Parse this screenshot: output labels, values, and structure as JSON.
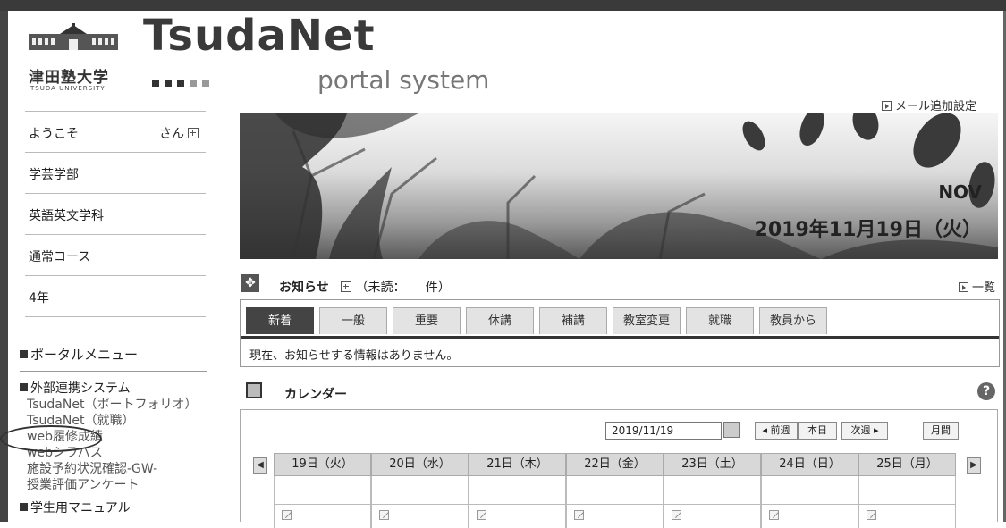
{
  "header": {
    "logo_jp": "津田塾大学",
    "logo_en": "TSUDA UNIVERSITY",
    "title": "TsudaNet",
    "subtitle": "portal system",
    "mail_setting": "メール追加設定"
  },
  "sidebar": {
    "welcome": "ようこそ",
    "san": "さん",
    "items": [
      "学芸学部",
      "英語英文学科",
      "通常コース",
      "4年"
    ],
    "portal_menu": "ポータルメニュー",
    "external_system": "外部連携システム",
    "external_links": [
      "TsudaNet（ポートフォリオ）",
      "TsudaNet（就職）",
      "web履修成績",
      "webシラバス",
      "施設予約状況確認-GW-",
      "授業評価アンケート"
    ],
    "student_manual": "学生用マニュアル"
  },
  "banner": {
    "month": "NOV",
    "date": "2019年11月19日（火）"
  },
  "notice": {
    "title": "お知らせ",
    "unread_prefix": "（未読：",
    "unread_suffix": "件）",
    "list_link": "一覧",
    "tabs": [
      "新着",
      "一般",
      "重要",
      "休講",
      "補講",
      "教室変更",
      "就職",
      "教員から"
    ],
    "active_tab": "新着",
    "empty_message": "現在、お知らせする情報はありません。"
  },
  "calendar": {
    "title": "カレンダー",
    "date_value": "2019/11/19",
    "prev_week": "◂ 前週",
    "today": "本日",
    "next_week": "次週 ▸",
    "month_view": "月間",
    "days": [
      "19日（火）",
      "20日（水）",
      "21日（木）",
      "22日（金）",
      "23日（土）",
      "24日（日）",
      "25日（月）"
    ]
  },
  "colors": {
    "active_tab": "#444444",
    "tab_bg": "#e3e3e3"
  }
}
